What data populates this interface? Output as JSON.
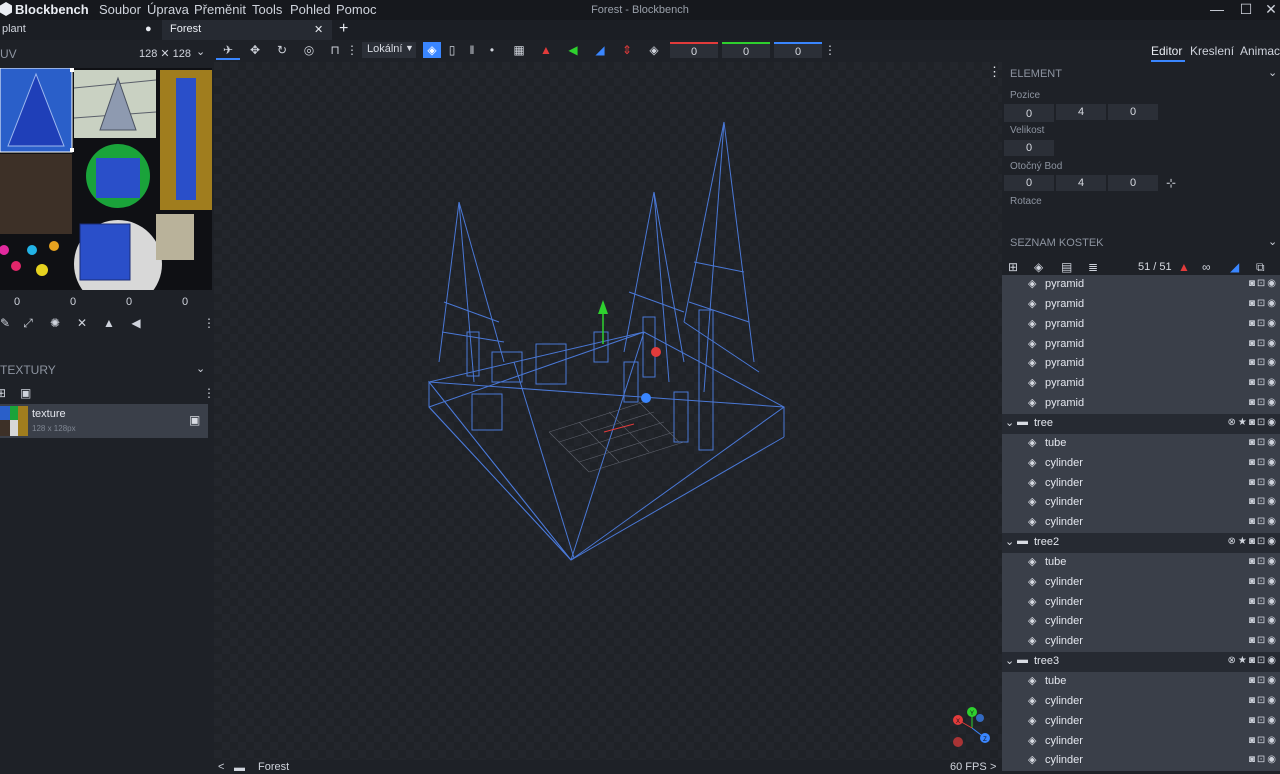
{
  "app": {
    "name": "Blockbench",
    "window_title": "Forest - Blockbench"
  },
  "menu": [
    "Soubor",
    "Úprava",
    "Přeměnit",
    "Tools",
    "Pohled",
    "Pomoc"
  ],
  "window_controls": {
    "minimize": "—",
    "maximize": "☐",
    "close": "✕"
  },
  "tabs": [
    {
      "label": "plant",
      "marker": "●"
    },
    {
      "label": "Forest",
      "close": "✕"
    }
  ],
  "new_tab": "+",
  "toolbar": {
    "space_select": "Lokální",
    "pos_values": [
      "0",
      "0",
      "0"
    ],
    "more": "⋮"
  },
  "mode_tabs": [
    "Editor",
    "Kreslení",
    "Animac"
  ],
  "uv": {
    "title": "UV",
    "size": "128 ✕ 128",
    "values": [
      "0",
      "0",
      "0",
      "0"
    ]
  },
  "textures": {
    "title": "TEXTURY",
    "items": [
      {
        "name": "texture",
        "size": "128 x 128px"
      }
    ]
  },
  "element": {
    "title": "ELEMENT",
    "position_label": "Pozice",
    "position": [
      "0",
      "4",
      "0"
    ],
    "size_label": "Velikost",
    "size": [
      "0"
    ],
    "pivot_label": "Otočný Bod",
    "pivot": [
      "0",
      "4",
      "0"
    ],
    "rotation_label": "Rotace"
  },
  "outliner": {
    "title": "SEZNAM KOSTEK",
    "count": "51 / 51",
    "rows": [
      {
        "type": "child",
        "name": "pyramid"
      },
      {
        "type": "child",
        "name": "pyramid"
      },
      {
        "type": "child",
        "name": "pyramid"
      },
      {
        "type": "child",
        "name": "pyramid"
      },
      {
        "type": "child",
        "name": "pyramid"
      },
      {
        "type": "child",
        "name": "pyramid"
      },
      {
        "type": "child",
        "name": "pyramid"
      },
      {
        "type": "group",
        "name": "tree"
      },
      {
        "type": "child",
        "name": "tube"
      },
      {
        "type": "child",
        "name": "cylinder"
      },
      {
        "type": "child",
        "name": "cylinder"
      },
      {
        "type": "child",
        "name": "cylinder"
      },
      {
        "type": "child",
        "name": "cylinder"
      },
      {
        "type": "group",
        "name": "tree2"
      },
      {
        "type": "child",
        "name": "tube"
      },
      {
        "type": "child",
        "name": "cylinder"
      },
      {
        "type": "child",
        "name": "cylinder"
      },
      {
        "type": "child",
        "name": "cylinder"
      },
      {
        "type": "child",
        "name": "cylinder"
      },
      {
        "type": "group",
        "name": "tree3"
      },
      {
        "type": "child",
        "name": "tube"
      },
      {
        "type": "child",
        "name": "cylinder"
      },
      {
        "type": "child",
        "name": "cylinder"
      },
      {
        "type": "child",
        "name": "cylinder"
      },
      {
        "type": "child",
        "name": "cylinder"
      }
    ]
  },
  "status": {
    "model_name": "Forest",
    "fps": "60 FPS",
    "prev": "<",
    "next": ">"
  },
  "gizmo": {
    "x": "X",
    "y": "Y",
    "z": "Z"
  },
  "colors": {
    "accent": "#3a86ff",
    "x_axis": "#e23b3b",
    "y_axis": "#2ed12e",
    "z_axis": "#3a86ff",
    "wire": "#4a78d6"
  }
}
